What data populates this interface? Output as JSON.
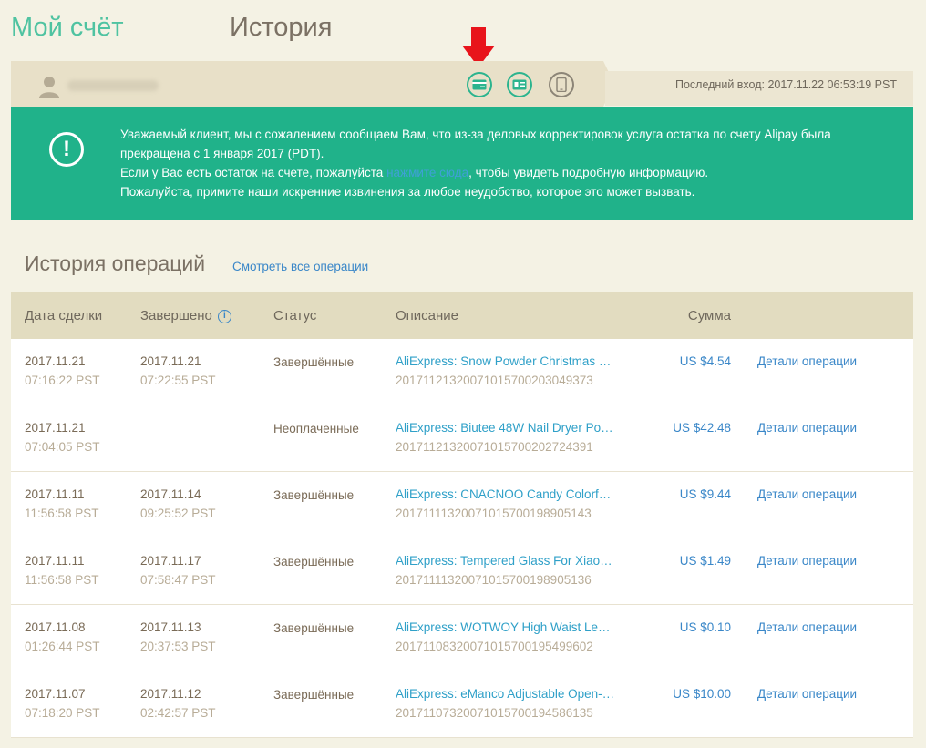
{
  "tabs": {
    "account": "Мой счёт",
    "history": "История"
  },
  "header": {
    "last_login": "Последний вход: 2017.11.22 06:53:19 PST",
    "icons": [
      "card-icon",
      "id-card-icon",
      "phone-icon"
    ]
  },
  "notice": {
    "line1": "Уважаемый клиент, мы с сожалением сообщаем Вам, что из-за деловых корректировок услуга остатка по счету Alipay была прекращена с 1 января 2017 (PDT).",
    "line2_prefix": "Если у Вас есть остаток на счете, пожалуйста ",
    "line2_link": "нажмите сюда",
    "line2_suffix": ", чтобы увидеть подробную информацию.",
    "line3": "Пожалуйста, примите наши искренние извинения за любое неудобство, которое это может вызвать."
  },
  "operations": {
    "title": "История операций",
    "view_all": "Смотреть все операции",
    "columns": {
      "date": "Дата сделки",
      "completed": "Завершено",
      "status": "Статус",
      "description": "Описание",
      "amount": "Сумма"
    },
    "rows": [
      {
        "date": "2017.11.21",
        "date_time": "07:16:22 PST",
        "completed": "2017.11.21",
        "completed_time": "07:22:55 PST",
        "status": "Завершённые",
        "description": "AliExpress: Snow Powder Christmas …",
        "txid": "20171121320071015700203049373",
        "amount": "US $4.54",
        "details": "Детали операции"
      },
      {
        "date": "2017.11.21",
        "date_time": "07:04:05 PST",
        "completed": "",
        "completed_time": "",
        "status": "Неоплаченные",
        "description": "AliExpress: Biutee 48W Nail Dryer Po…",
        "txid": "20171121320071015700202724391",
        "amount": "US $42.48",
        "details": "Детали операции"
      },
      {
        "date": "2017.11.11",
        "date_time": "11:56:58 PST",
        "completed": "2017.11.14",
        "completed_time": "09:25:52 PST",
        "status": "Завершённые",
        "description": "AliExpress: CNACNOO Candy Colorf…",
        "txid": "20171111320071015700198905143",
        "amount": "US $9.44",
        "details": "Детали операции"
      },
      {
        "date": "2017.11.11",
        "date_time": "11:56:58 PST",
        "completed": "2017.11.17",
        "completed_time": "07:58:47 PST",
        "status": "Завершённые",
        "description": "AliExpress: Tempered Glass For Xiao…",
        "txid": "20171111320071015700198905136",
        "amount": "US $1.49",
        "details": "Детали операции"
      },
      {
        "date": "2017.11.08",
        "date_time": "01:26:44 PST",
        "completed": "2017.11.13",
        "completed_time": "20:37:53 PST",
        "status": "Завершённые",
        "description": "AliExpress: WOTWOY High Waist Le…",
        "txid": "20171108320071015700195499602",
        "amount": "US $0.10",
        "details": "Детали операции"
      },
      {
        "date": "2017.11.07",
        "date_time": "07:18:20 PST",
        "completed": "2017.11.12",
        "completed_time": "02:42:57 PST",
        "status": "Завершённые",
        "description": "AliExpress: eManco Adjustable Open-…",
        "txid": "20171107320071015700194586135",
        "amount": "US $10.00",
        "details": "Детали операции"
      }
    ]
  }
}
